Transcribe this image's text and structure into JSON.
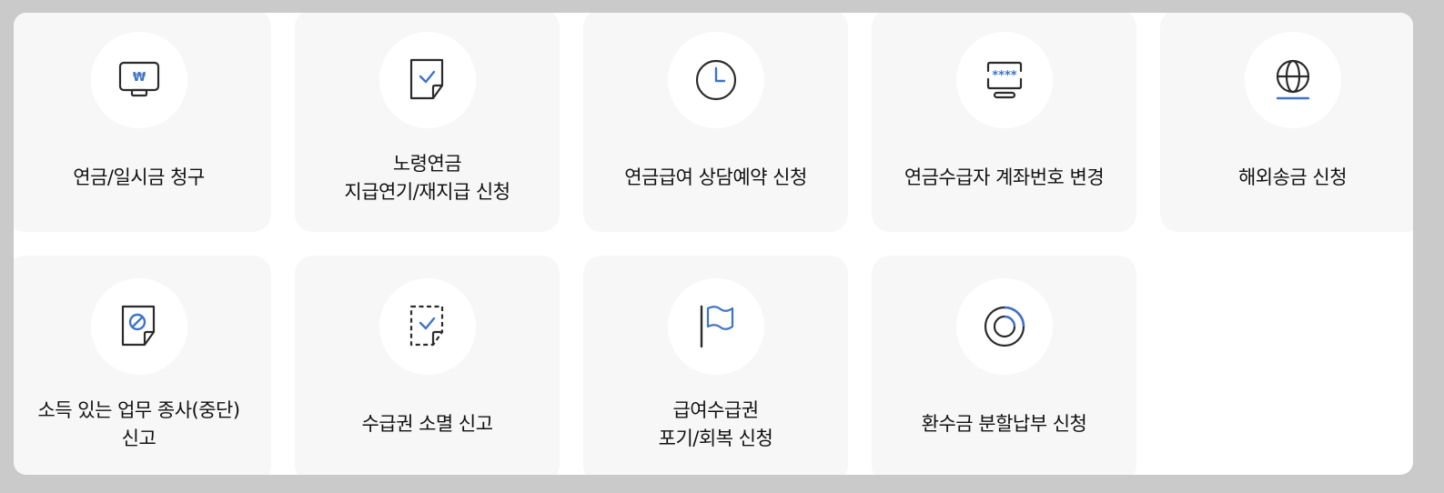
{
  "colors": {
    "accent": "#3f73c9",
    "ink": "#2b2b2b",
    "card_bg": "#f7f7f7"
  },
  "services": [
    {
      "icon": "monitor-won-icon",
      "lines": [
        "연금/일시금 청구"
      ]
    },
    {
      "icon": "document-check-icon",
      "lines": [
        "노령연금",
        "지급연기/재지급 신청"
      ]
    },
    {
      "icon": "clock-icon",
      "lines": [
        "연금급여 상담예약 신청"
      ]
    },
    {
      "icon": "password-monitor-icon",
      "lines": [
        "연금수급자 계좌번호 변경"
      ]
    },
    {
      "icon": "globe-icon",
      "lines": [
        "해외송금 신청"
      ]
    },
    {
      "icon": "document-prohibited-icon",
      "lines": [
        "소득 있는 업무 종사(중단)",
        "신고"
      ]
    },
    {
      "icon": "dashed-document-check-icon",
      "lines": [
        "수급권 소멸 신고"
      ]
    },
    {
      "icon": "flag-icon",
      "lines": [
        "급여수급권",
        "포기/회복 신청"
      ]
    },
    {
      "icon": "refund-circle-icon",
      "lines": [
        "환수금 분할납부 신청"
      ]
    }
  ]
}
